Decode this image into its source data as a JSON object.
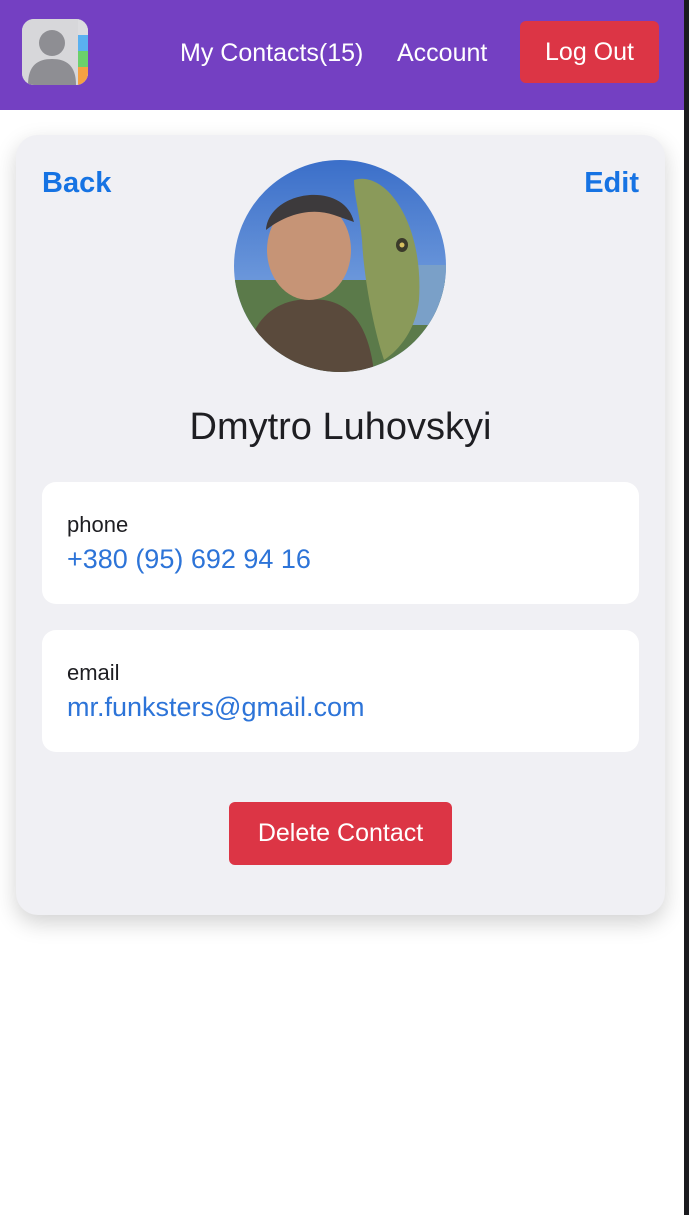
{
  "header": {
    "logo_alt": "Contacts app",
    "my_contacts_label": "My Contacts(15)",
    "account_label": "Account",
    "logout_label": "Log Out"
  },
  "card": {
    "back_label": "Back",
    "edit_label": "Edit",
    "contact_name": "Dmytro Luhovskyi",
    "phone": {
      "label": "phone",
      "value": "+380 (95) 692 94 16"
    },
    "email": {
      "label": "email",
      "value": "mr.funksters@gmail.com"
    },
    "delete_label": "Delete Contact"
  },
  "colors": {
    "header_bg": "#7440c2",
    "danger": "#dc3545",
    "link": "#1673e3",
    "card_bg": "#f0f0f4"
  },
  "icons": [
    "contacts-app-icon",
    "contact-avatar-photo"
  ]
}
